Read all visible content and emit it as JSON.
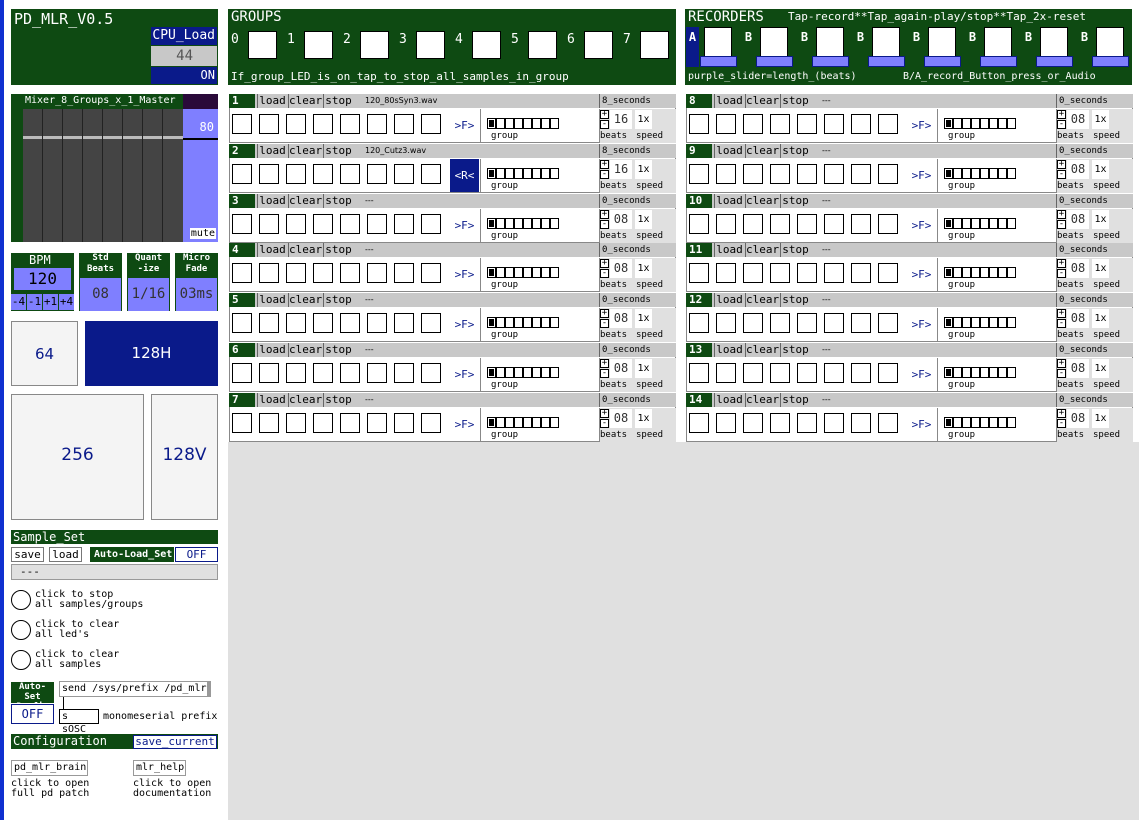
{
  "app": {
    "title": "PD_MLR_V0.5",
    "cpu_label": "CPU_Load",
    "cpu_value": "44",
    "on_label": "ON"
  },
  "mixer": {
    "title": "Mixer_8_Groups_x_1_Master",
    "master_value": "80",
    "mute_label": "mute"
  },
  "bpm": {
    "label": "BPM",
    "value": "120",
    "adj": [
      "-4",
      "-1",
      "+1",
      "+4"
    ],
    "std_label": "Std\nBeats",
    "std_value": "08",
    "quant_label": "Quant\n-ize",
    "quant_value": "1/16",
    "micro_label": "Micro\nFade",
    "micro_value": "03ms"
  },
  "grids": {
    "g64": "64",
    "g128h": "128H",
    "g256": "256",
    "g128v": "128V"
  },
  "sample_set": {
    "title": "Sample_Set",
    "save": "save",
    "load": "load",
    "autoload_label": "Auto-Load_Set",
    "autoload_value": "OFF",
    "value": "---"
  },
  "actions": [
    {
      "line1": "click to stop",
      "line2": "all samples/groups"
    },
    {
      "line1": "click to clear",
      "line2": "all led's"
    },
    {
      "line1": "click to clear",
      "line2": "all samples"
    }
  ],
  "prefix": {
    "label": "Auto-Set\nPrefix",
    "value": "OFF",
    "send": "send /sys/prefix /pd_mlr",
    "s_osc": "s sOSC",
    "mono": "monomeserial prefix"
  },
  "config": {
    "title": "Configuration",
    "save_current": "save_current",
    "brain": "pd_mlr_brain",
    "brain_desc1": "click to open",
    "brain_desc2": "full pd patch",
    "help": "mlr_help",
    "help_desc1": "click to open",
    "help_desc2": "documentation"
  },
  "groups": {
    "title": "GROUPS",
    "numbers": [
      "0",
      "1",
      "2",
      "3",
      "4",
      "5",
      "6",
      "7"
    ],
    "footer": "If_group_LED_is_on_tap_to_stop_all_samples_in_group"
  },
  "recorders": {
    "title": "RECORDERS",
    "instructions": "Tap-record**Tap_again-play/stop**Tap_2x-reset",
    "ab": [
      "A",
      "B",
      "B",
      "B",
      "B",
      "B",
      "B",
      "B"
    ],
    "val": "08",
    "beats": "beats",
    "footer1": "purple_slider=length_(beats)",
    "footer2": "B/A_record_Button_press_or_Audio"
  },
  "row_labels": {
    "load": "load",
    "clear": "clear",
    "stop": "stop",
    "fwd": ">F>",
    "rev": "<R<",
    "group": "group",
    "beats": "beats",
    "speed": "speed"
  },
  "rows_left": [
    {
      "num": "1",
      "file": "120_80sSyn3.wav",
      "secs": "8_seconds",
      "beats": "16",
      "speed": "1x",
      "dir": ">F>",
      "rev": false
    },
    {
      "num": "2",
      "file": "120_Cutz3.wav",
      "secs": "8_seconds",
      "beats": "16",
      "speed": "1x",
      "dir": "<R<",
      "rev": true
    },
    {
      "num": "3",
      "file": "---",
      "secs": "0_seconds",
      "beats": "08",
      "speed": "1x",
      "dir": ">F>",
      "rev": false
    },
    {
      "num": "4",
      "file": "---",
      "secs": "0_seconds",
      "beats": "08",
      "speed": "1x",
      "dir": ">F>",
      "rev": false
    },
    {
      "num": "5",
      "file": "---",
      "secs": "0_seconds",
      "beats": "08",
      "speed": "1x",
      "dir": ">F>",
      "rev": false
    },
    {
      "num": "6",
      "file": "---",
      "secs": "0_seconds",
      "beats": "08",
      "speed": "1x",
      "dir": ">F>",
      "rev": false
    },
    {
      "num": "7",
      "file": "---",
      "secs": "0_seconds",
      "beats": "08",
      "speed": "1x",
      "dir": ">F>",
      "rev": false
    }
  ],
  "rows_right": [
    {
      "num": "8",
      "file": "---",
      "secs": "0_seconds",
      "beats": "08",
      "speed": "1x",
      "dir": ">F>",
      "rev": false
    },
    {
      "num": "9",
      "file": "---",
      "secs": "0_seconds",
      "beats": "08",
      "speed": "1x",
      "dir": ">F>",
      "rev": false
    },
    {
      "num": "10",
      "file": "---",
      "secs": "0_seconds",
      "beats": "08",
      "speed": "1x",
      "dir": ">F>",
      "rev": false
    },
    {
      "num": "11",
      "file": "---",
      "secs": "0_seconds",
      "beats": "08",
      "speed": "1x",
      "dir": ">F>",
      "rev": false
    },
    {
      "num": "12",
      "file": "---",
      "secs": "0_seconds",
      "beats": "08",
      "speed": "1x",
      "dir": ">F>",
      "rev": false
    },
    {
      "num": "13",
      "file": "---",
      "secs": "0_seconds",
      "beats": "08",
      "speed": "1x",
      "dir": ">F>",
      "rev": false
    },
    {
      "num": "14",
      "file": "---",
      "secs": "0_seconds",
      "beats": "08",
      "speed": "1x",
      "dir": ">F>",
      "rev": false
    }
  ]
}
